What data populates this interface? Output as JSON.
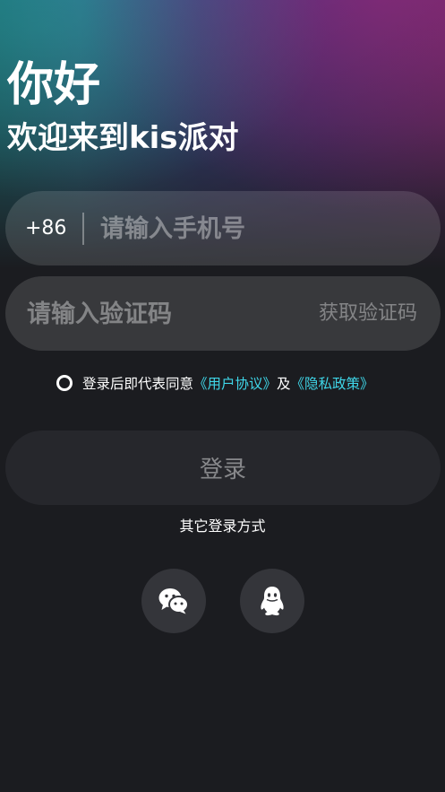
{
  "header": {
    "greeting": "你好",
    "welcome": "欢迎来到kis派对"
  },
  "phone_field": {
    "country_code": "+86",
    "value": "",
    "placeholder": "请输入手机号"
  },
  "code_field": {
    "value": "",
    "placeholder": "请输入验证码",
    "get_code_label": "获取验证码"
  },
  "agreement": {
    "checked": false,
    "prefix": "登录后即代表同意",
    "user_agreement": "《用户协议》",
    "conjunction": "及",
    "privacy_policy": "《隐私政策》"
  },
  "login_button": {
    "label": "登录"
  },
  "other_login": {
    "label": "其它登录方式",
    "methods": [
      {
        "icon": "wechat-icon"
      },
      {
        "icon": "qq-icon"
      }
    ]
  },
  "colors": {
    "background": "#1b1c20",
    "link": "#3fd6e8",
    "field": "rgba(255,255,255,0.13)"
  }
}
